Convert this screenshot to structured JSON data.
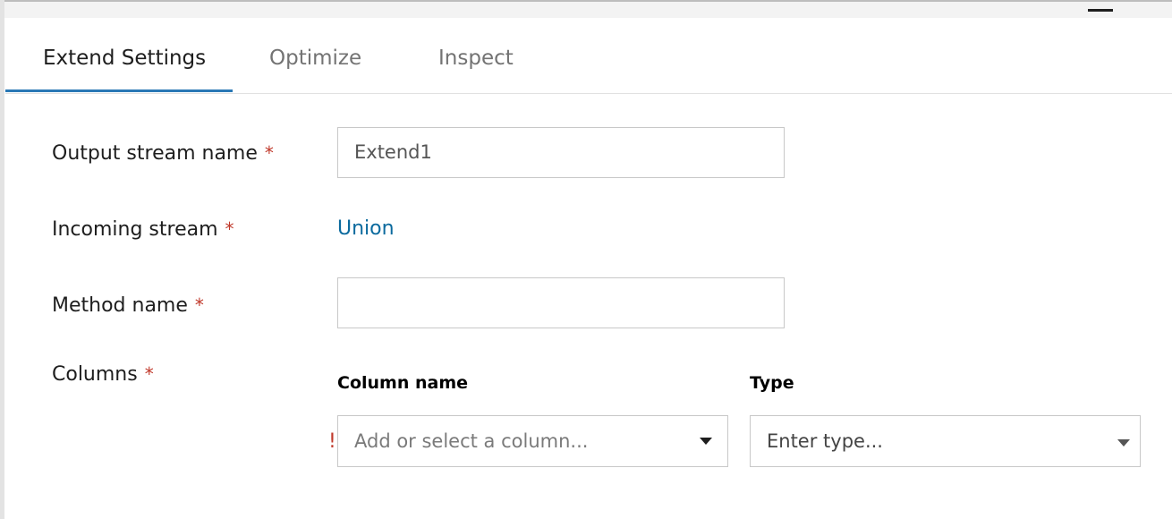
{
  "tabs": [
    {
      "label": "Extend Settings",
      "active": true
    },
    {
      "label": "Optimize",
      "active": false
    },
    {
      "label": "Inspect",
      "active": false
    }
  ],
  "form": {
    "required_marker": "*",
    "output_stream": {
      "label": "Output stream name",
      "value": "Extend1"
    },
    "incoming_stream": {
      "label": "Incoming stream",
      "value": "Union"
    },
    "method_name": {
      "label": "Method name",
      "value": ""
    },
    "columns": {
      "label": "Columns",
      "column_name_header": "Column name",
      "type_header": "Type",
      "error_mark": "!",
      "column_placeholder": "Add or select a column...",
      "type_placeholder": "Enter type..."
    }
  },
  "colors": {
    "accent": "#2a78b5",
    "link": "#0b6a9e",
    "required": "#c0392b"
  },
  "icons": {
    "minimize": "minimize-icon",
    "dropdown": "chevron-down-icon"
  }
}
